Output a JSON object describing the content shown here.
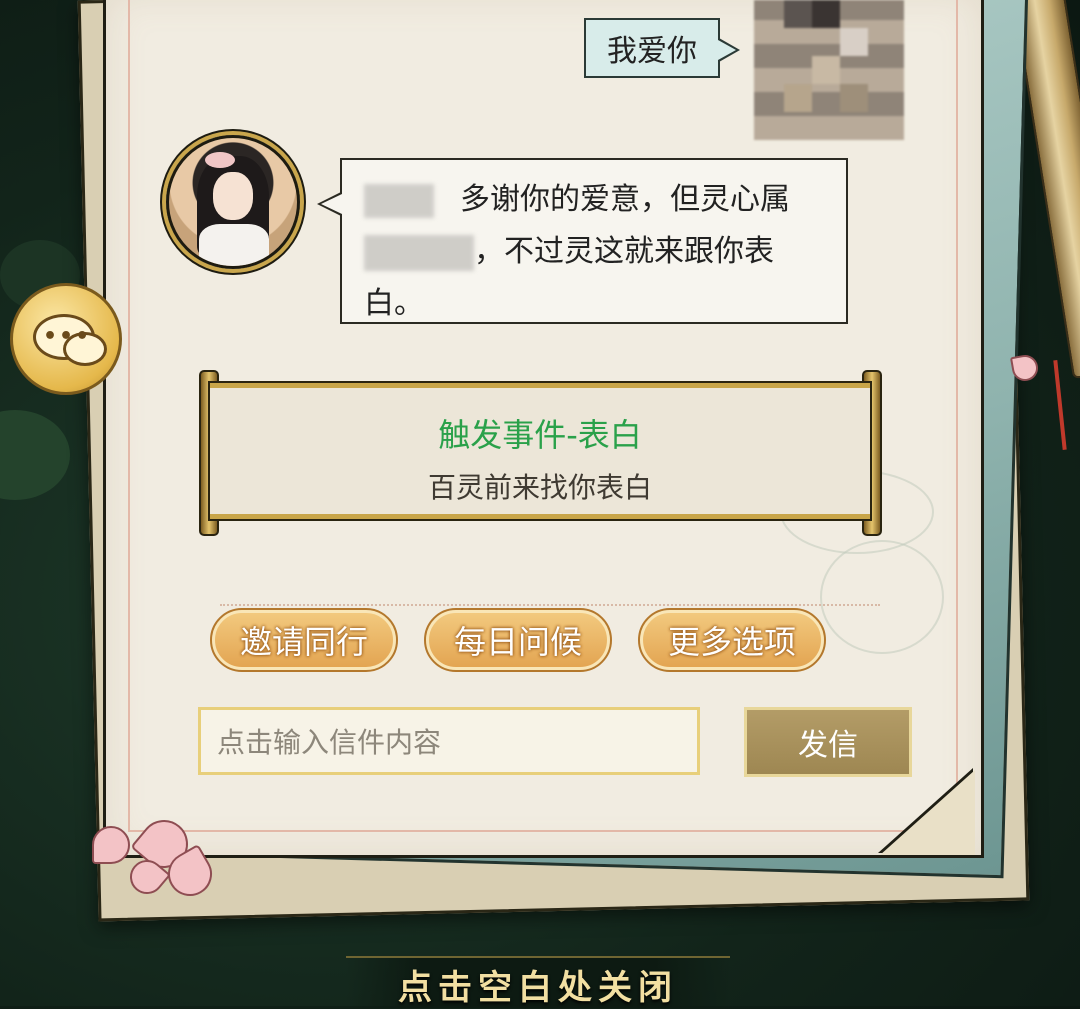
{
  "chat": {
    "user_message": "我爱你",
    "npc_message_part1": "多谢你的爱意，但灵心属",
    "npc_message_part2": "，不过灵这就来跟你表",
    "npc_message_part3": "白。"
  },
  "event": {
    "title": "触发事件-表白",
    "description": "百灵前来找你表白"
  },
  "actions": [
    {
      "label": "邀请同行"
    },
    {
      "label": "每日问候"
    },
    {
      "label": "更多选项"
    }
  ],
  "compose": {
    "placeholder": "点击输入信件内容",
    "send_label": "发信"
  },
  "footer": {
    "close_hint": "点击空白处关闭"
  },
  "colors": {
    "event_title": "#2aa14a",
    "action_button": "#e3a552",
    "send_button": "#9e8752"
  },
  "icons": {
    "chat": "chat-bubbles-icon"
  }
}
